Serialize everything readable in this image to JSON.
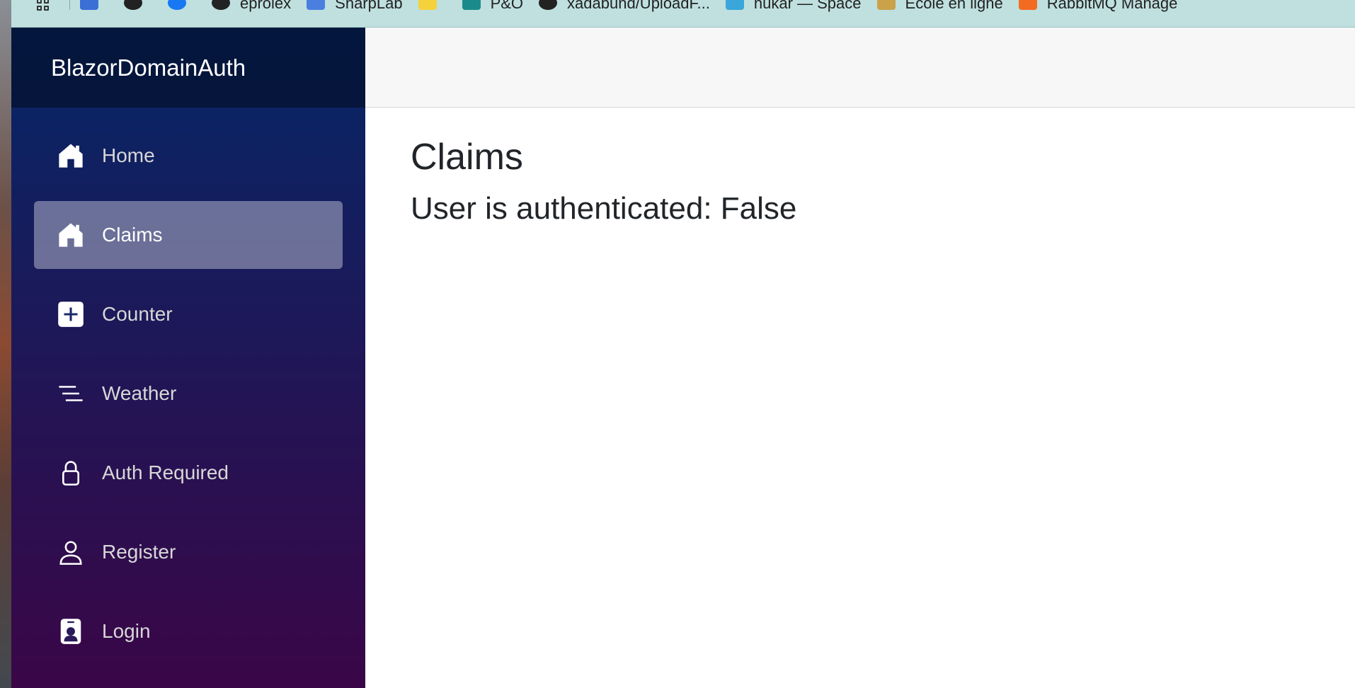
{
  "bookmarks": [
    {
      "label": "",
      "icon": "mail-icon",
      "color": "#3b6fd6"
    },
    {
      "label": "",
      "icon": "github-icon",
      "color": "#222222"
    },
    {
      "label": "",
      "icon": "facebook-icon",
      "color": "#1877f2"
    },
    {
      "label": "eprolex",
      "icon": "globe-icon",
      "color": "#222222"
    },
    {
      "label": "SharpLab",
      "icon": "sharplab-icon",
      "color": "#4a7fe0"
    },
    {
      "label": "",
      "icon": "miro-icon",
      "color": "#f5d13b"
    },
    {
      "label": "P&O",
      "icon": "sharepoint-icon",
      "color": "#1b8a8a"
    },
    {
      "label": "xadabund/UploadF...",
      "icon": "github-icon",
      "color": "#222222"
    },
    {
      "label": "nukar — Space",
      "icon": "space-icon",
      "color": "#3aa6d9"
    },
    {
      "label": "École en ligne",
      "icon": "school-icon",
      "color": "#c9a24a"
    },
    {
      "label": "RabbitMQ Manage",
      "icon": "rabbitmq-icon",
      "color": "#f26b21"
    }
  ],
  "sidebar": {
    "brand": "BlazorDomainAuth",
    "items": [
      {
        "label": "Home",
        "icon": "home-icon"
      },
      {
        "label": "Claims",
        "icon": "home-icon"
      },
      {
        "label": "Counter",
        "icon": "plus-square-icon"
      },
      {
        "label": "Weather",
        "icon": "list-lines-icon"
      },
      {
        "label": "Auth Required",
        "icon": "lock-icon"
      },
      {
        "label": "Register",
        "icon": "person-icon"
      },
      {
        "label": "Login",
        "icon": "person-badge-icon"
      }
    ],
    "active_item": "Claims"
  },
  "main": {
    "title": "Claims",
    "status": "User is authenticated: False"
  }
}
